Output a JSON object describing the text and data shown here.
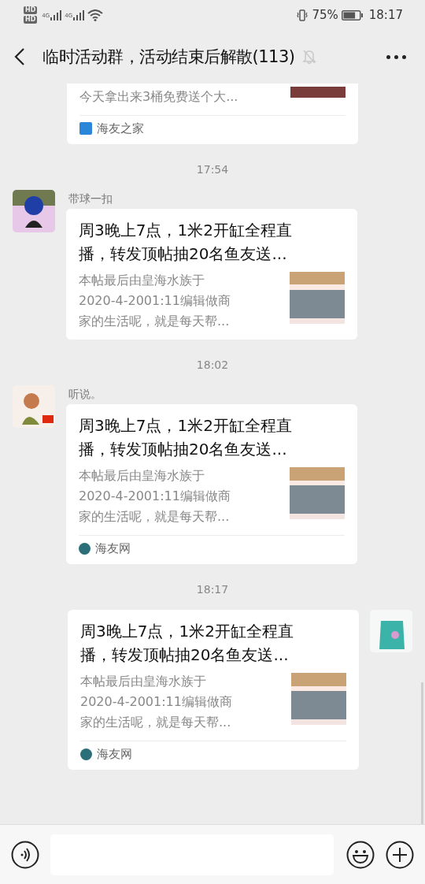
{
  "status_bar": {
    "hd_badges": [
      "HD",
      "HD"
    ],
    "network_labels": [
      "4G",
      "4G"
    ],
    "battery_text": "75%",
    "time": "18:17"
  },
  "header": {
    "title": "临时活动群，活动结束后解散(113)",
    "muted": true
  },
  "chat": [
    {
      "kind": "message",
      "outgoing": false,
      "card": {
        "kind": "partial",
        "description": [
          "今天拿出来3桶免费送个大..."
        ],
        "source": "海友之家"
      }
    },
    {
      "kind": "time",
      "text": "17:54"
    },
    {
      "kind": "message",
      "outgoing": false,
      "sender": "带球一扣",
      "card": {
        "kind": "full",
        "title": [
          "周3晚上7点，1米2开缸全程直",
          "播，转发顶帖抽20名鱼友送..."
        ],
        "description": [
          "本帖最后由皇海水族于",
          "2020-4-2001:11编辑做商",
          "家的生活呢，就是每天帮..."
        ]
      }
    },
    {
      "kind": "time",
      "text": "18:02"
    },
    {
      "kind": "message",
      "outgoing": false,
      "sender": "听说。",
      "card": {
        "kind": "full",
        "title": [
          "周3晚上7点，1米2开缸全程直",
          "播，转发顶帖抽20名鱼友送..."
        ],
        "description": [
          "本帖最后由皇海水族于",
          "2020-4-2001:11编辑做商",
          "家的生活呢，就是每天帮..."
        ],
        "source": "海友网"
      }
    },
    {
      "kind": "time",
      "text": "18:17"
    },
    {
      "kind": "message",
      "outgoing": true,
      "card": {
        "kind": "full",
        "title": [
          "周3晚上7点，1米2开缸全程直",
          "播，转发顶帖抽20名鱼友送..."
        ],
        "description": [
          "本帖最后由皇海水族于",
          "2020-4-2001:11编辑做商",
          "家的生活呢，就是每天帮..."
        ],
        "source": "海友网"
      }
    }
  ]
}
